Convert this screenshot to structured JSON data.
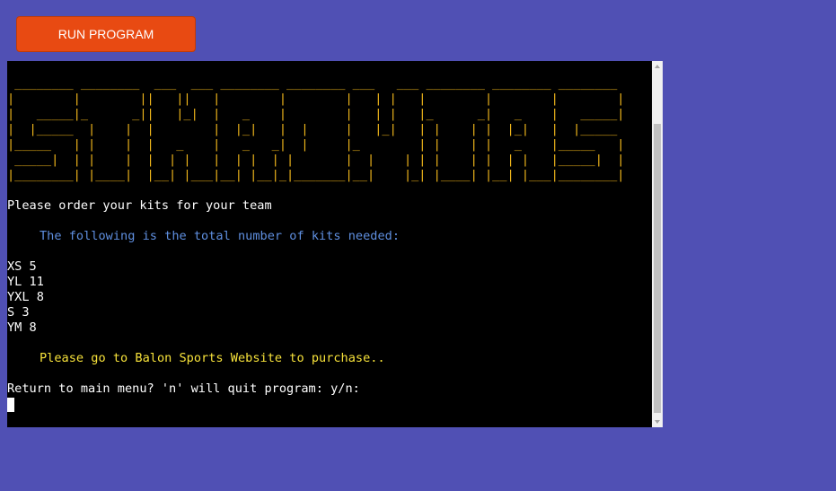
{
  "toolbar": {
    "run_label": "RUN PROGRAM"
  },
  "terminal": {
    "prompt_order": "Please order your kits for your team",
    "kits_heading": "The following is the total number of kits needed:",
    "kits": [
      {
        "size": "XS",
        "count": 5
      },
      {
        "size": "YL",
        "count": 11
      },
      {
        "size": "YXL",
        "count": 8
      },
      {
        "size": "S",
        "count": 3
      },
      {
        "size": "YM",
        "count": 8
      }
    ],
    "kit_lines": [
      "XS 5",
      "YL 11",
      "YXL 8",
      "S 3",
      "YM 8"
    ],
    "purchase_message": "Please go to Balon Sports Website to purchase..",
    "return_prompt": "Return to main menu? 'n' will quit program: y/n:"
  },
  "colors": {
    "page_background": "#5050b4",
    "button_background": "#e84a12",
    "terminal_background": "#000000",
    "banner_text": "#f2b81b",
    "heading_text": "#5f8fe0",
    "purchase_text": "#f7e23a"
  }
}
